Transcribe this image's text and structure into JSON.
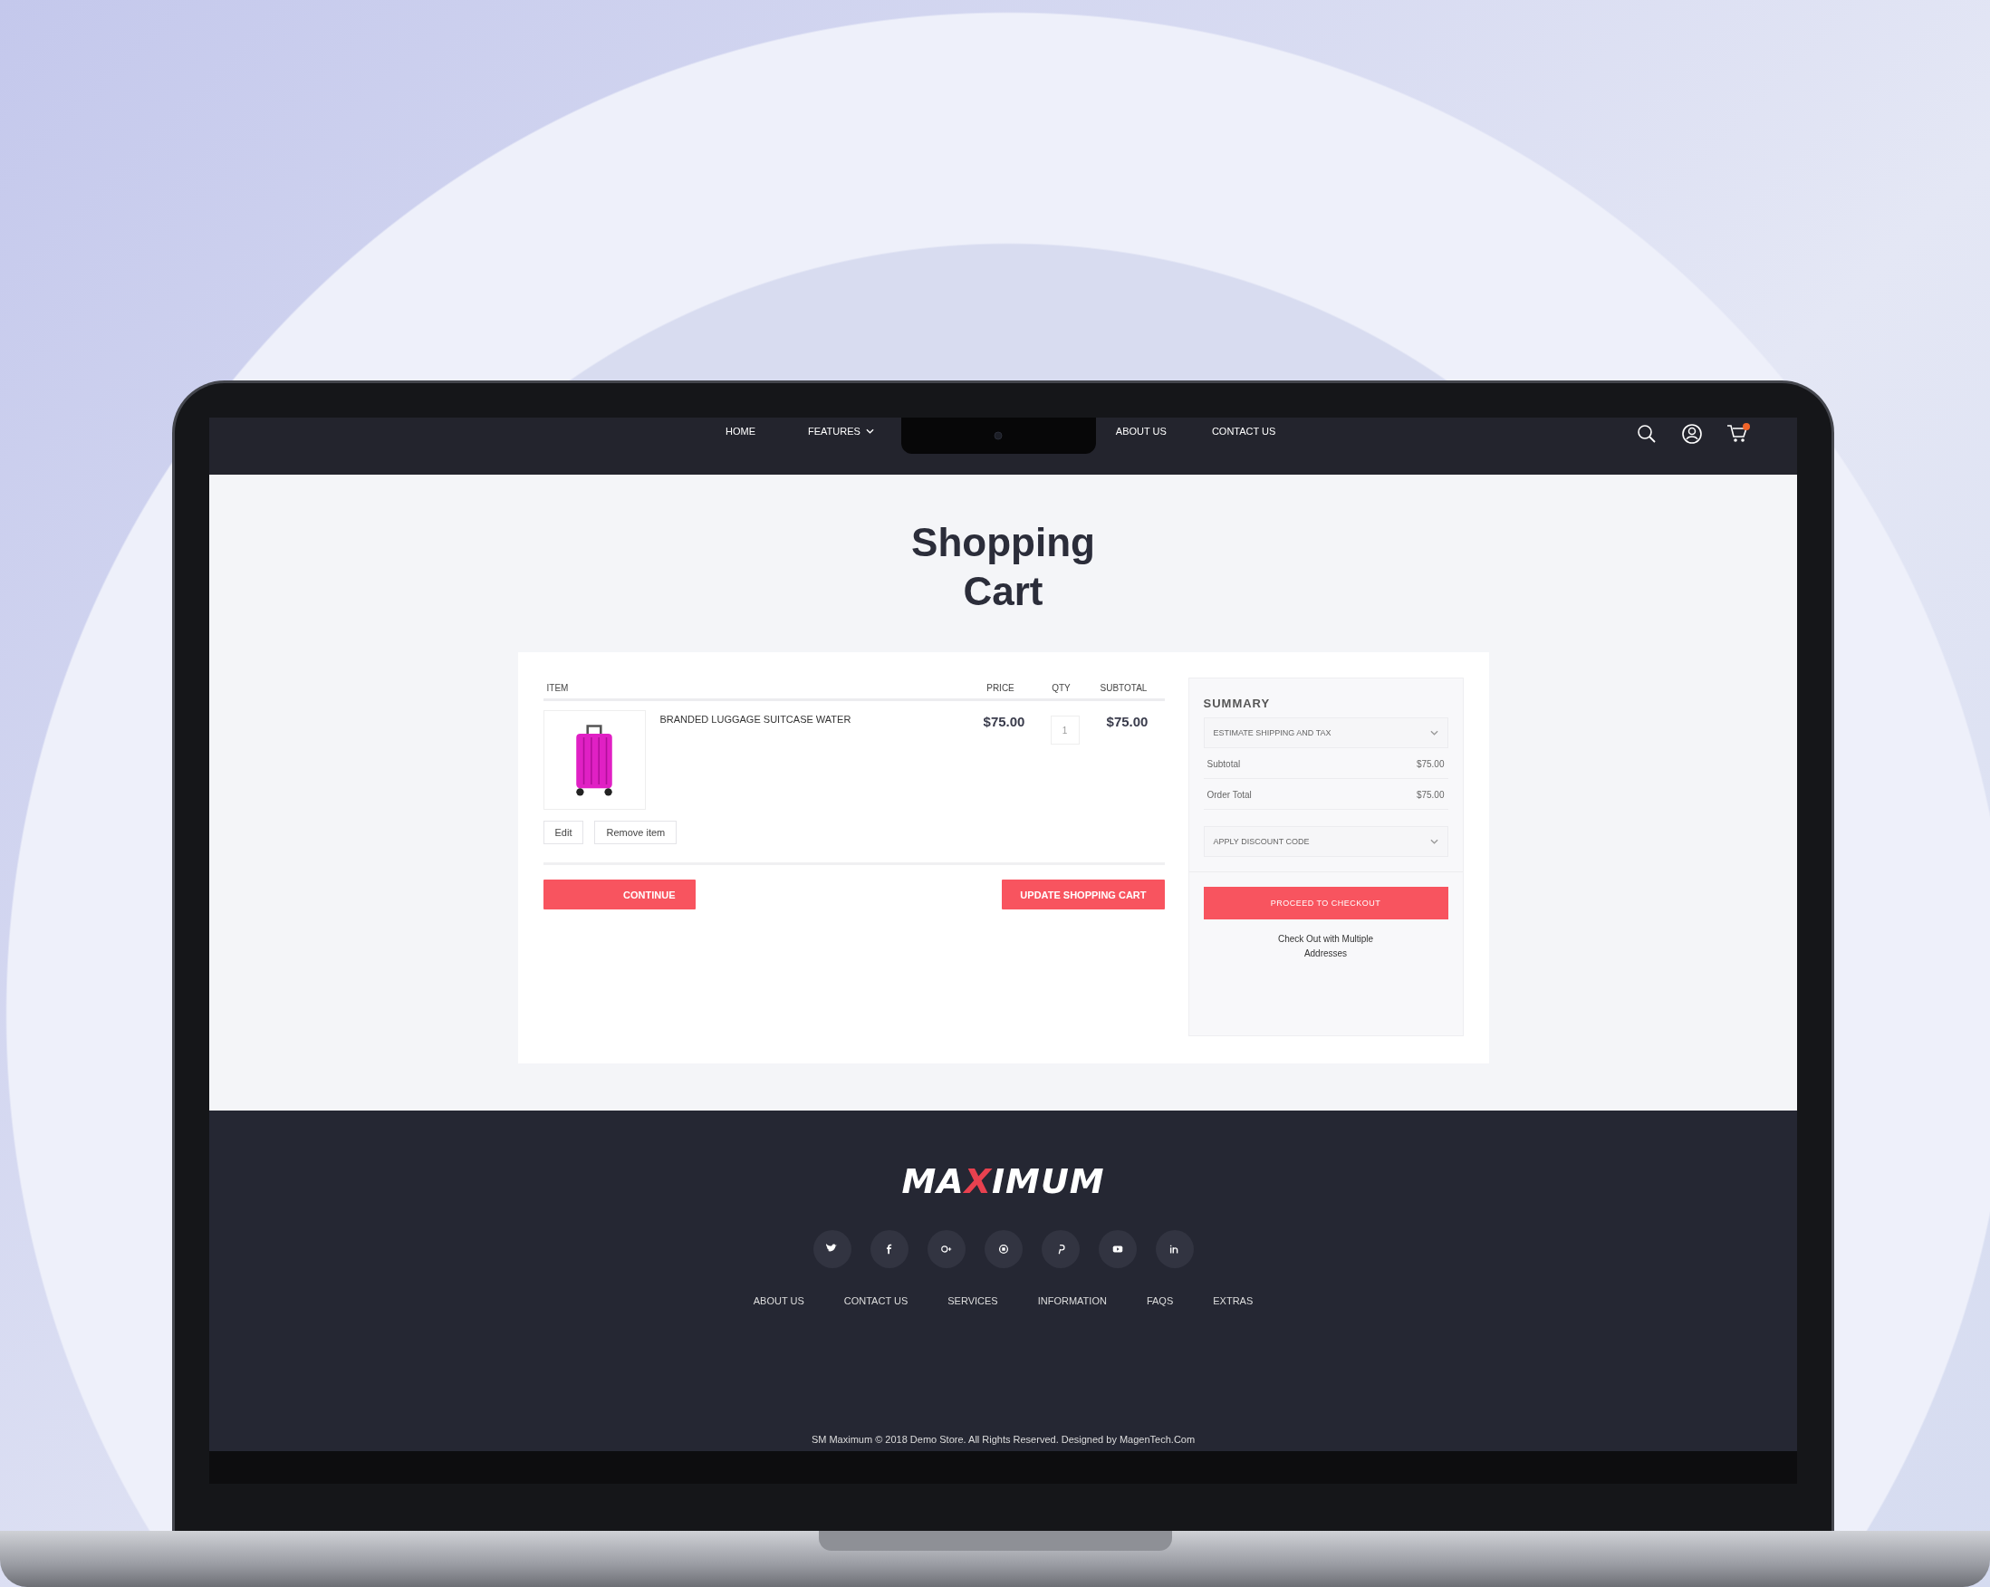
{
  "nav": {
    "links": [
      {
        "label": "HOME",
        "dropdown": false
      },
      {
        "label": "FEATURES",
        "dropdown": true
      },
      {
        "label": "ABOUT US",
        "dropdown": false
      },
      {
        "label": "CONTACT US",
        "dropdown": false
      }
    ]
  },
  "page_title": "Shopping Cart",
  "cart": {
    "columns": [
      "ITEM",
      "PRICE",
      "QTY",
      "SUBTOTAL"
    ],
    "items": [
      {
        "name": "BRANDED LUGGAGE SUITCASE WATER",
        "price": "$75.00",
        "qty": "1",
        "subtotal": "$75.00",
        "actions": [
          "Edit",
          "Remove item"
        ]
      }
    ],
    "buttons": [
      "CONTINUE",
      "UPDATE SHOPPING CART"
    ]
  },
  "summary": {
    "title": "SUMMARY",
    "shipping": "ESTIMATE SHIPPING AND TAX",
    "totals": [
      {
        "label": "Subtotal",
        "value": "$75.00"
      },
      {
        "label": "Order Total",
        "value": "$75.00"
      }
    ],
    "discount": "APPLY DISCOUNT CODE",
    "checkout": "PROCEED TO CHECKOUT",
    "multi_address": "Check Out with Multiple Addresses"
  },
  "footer": {
    "logo": [
      {
        "text": "MA",
        "accent": false
      },
      {
        "text": "X",
        "accent": true
      },
      {
        "text": "IMUM",
        "accent": false
      }
    ],
    "links": [
      "ABOUT US",
      "CONTACT US",
      "SERVICES",
      "INFORMATION",
      "FAQS",
      "EXTRAS"
    ],
    "copyright": "SM Maximum © 2018 Demo Store. All Rights Reserved. Designed by MagenTech.Com"
  }
}
